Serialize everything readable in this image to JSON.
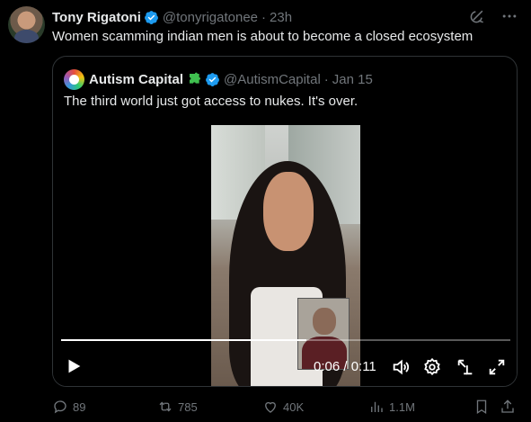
{
  "tweet": {
    "author_name": "Tony Rigatoni",
    "author_handle": "@tonyrigatonee",
    "separator": "·",
    "time": "23h",
    "text": "Women scamming indian men is about to become a closed ecosystem",
    "verified_icon": "verified-badge-icon",
    "top_icons": [
      "grok-icon",
      "more-icon"
    ]
  },
  "quote": {
    "author_name": "Autism Capital",
    "author_emoji_icon": "puzzle-piece-icon",
    "author_handle": "@AutismCapital",
    "separator": "·",
    "date": "Jan 15",
    "text": "The third world just got access to nukes. It's over."
  },
  "video": {
    "current_time": "0:06",
    "duration": "0:11",
    "time_display": "0:06 / 0:11",
    "progress": 0.545,
    "controls": [
      "play-icon",
      "volume-icon",
      "settings-icon",
      "pop-out-icon",
      "fullscreen-icon"
    ]
  },
  "actions": {
    "replies": "89",
    "reposts": "785",
    "likes": "40K",
    "views": "1.1M"
  },
  "colors": {
    "background": "#000000",
    "text": "#e7e9ea",
    "muted": "#71767b",
    "verified": "#1d9bf0",
    "border": "#2f3336"
  }
}
